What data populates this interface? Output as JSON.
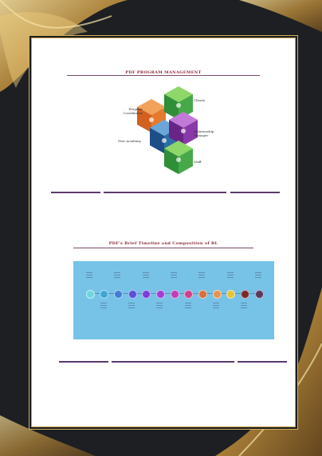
{
  "document": {
    "section1": {
      "title": "PDF PROGRAM MANAGEMENT",
      "labels": {
        "program_coordinator": "Program Coordinator",
        "clients": "Clients",
        "relationship_manager": "Relationship Manager",
        "peer_academy": "Peer Academy",
        "staff": "Staff"
      }
    },
    "section2": {
      "title": "PDF's Brief Timeline and Composition of BL"
    },
    "colors": {
      "title": "#8a2a3a",
      "timeline_bg": "#77c3e8",
      "gold": "#d4b15d",
      "cube_orange": "#e07a2e",
      "cube_green": "#47a84a",
      "cube_purple": "#8a3aa8",
      "cube_blue": "#2e6ea8"
    },
    "timeline_dot_colors": [
      "#6fd6e0",
      "#3fa7d6",
      "#3f7fd6",
      "#5a4fd6",
      "#7a3fd6",
      "#a03fd6",
      "#c03fb8",
      "#d03f8a",
      "#d6703f",
      "#e6944f",
      "#e6c23f",
      "#7a2a2a",
      "#5a3a5a"
    ],
    "icons": [
      "cube-graphic-icon"
    ]
  }
}
